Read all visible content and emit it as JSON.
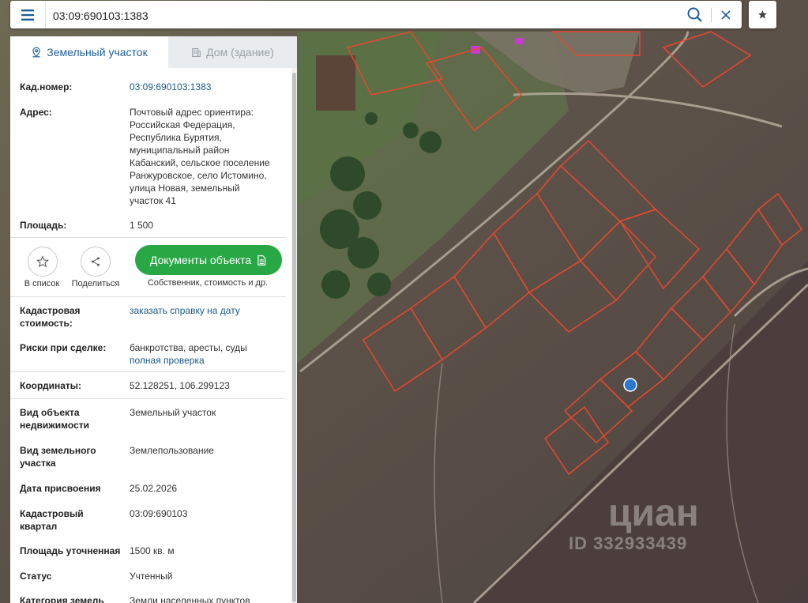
{
  "search": {
    "value": "03:09:690103:1383"
  },
  "icons": {
    "menu": "hamburger-icon",
    "search": "search-icon",
    "clear": "close-icon",
    "favorite": "star-icon"
  },
  "tabs": [
    {
      "label": "Земельный участок",
      "icon": "map-pin-icon",
      "active": true
    },
    {
      "label": "Дом (здание)",
      "icon": "building-icon",
      "active": false
    }
  ],
  "info": {
    "cad_number": {
      "label": "Кад.номер:",
      "value": "03:09:690103:1383"
    },
    "address": {
      "label": "Адрес:",
      "lines": [
        "Почтовый адрес ориентира:",
        "Российская Федерация,",
        "Республика Бурятия,",
        "муниципальный район",
        "Кабанский, сельское поселение",
        "Ранжуровское, село Истомино,",
        "улица Новая, земельный",
        "участок 41"
      ]
    },
    "area": {
      "label": "Площадь:",
      "value": "1 500"
    }
  },
  "actions": {
    "to_list": "В список",
    "share": "Поделиться",
    "docs_button": "Документы объекта",
    "docs_sub": "Собственник, стоимость и др."
  },
  "details": {
    "cad_cost": {
      "label_1": "Кадастровая",
      "label_2": "стоимость:",
      "link": "заказать справку на дату"
    },
    "risks": {
      "label": "Риски при сделке:",
      "value": "банкротства, аресты, суды",
      "link": "полная проверка"
    },
    "coords": {
      "label": "Координаты:",
      "value": "52.128251, 106.299123"
    },
    "object_type": {
      "label_1": "Вид объекта",
      "label_2": "недвижимости",
      "value": "Земельный участок"
    },
    "land_type": {
      "label_1": "Вид земельного",
      "label_2": "участка",
      "value": "Землепользование"
    },
    "assign_date": {
      "label": "Дата присвоения",
      "value": "25.02.2026"
    },
    "cad_quarter": {
      "label_1": "Кадастровый",
      "label_2": "квартал",
      "value": "03:09:690103"
    },
    "refined_area": {
      "label": "Площадь уточненная",
      "value": "1500 кв. м"
    },
    "status": {
      "label": "Статус",
      "value": "Учтенный"
    },
    "category": {
      "label": "Категория земель",
      "value": "Земли населенных пунктов"
    }
  },
  "watermark": {
    "brand": "циан",
    "id": "ID 332933439"
  },
  "colors": {
    "accent_green": "#28a745",
    "link_blue": "#1a5a8a",
    "parcel_red": "#e8472e",
    "marker_blue": "#2a78d2"
  }
}
